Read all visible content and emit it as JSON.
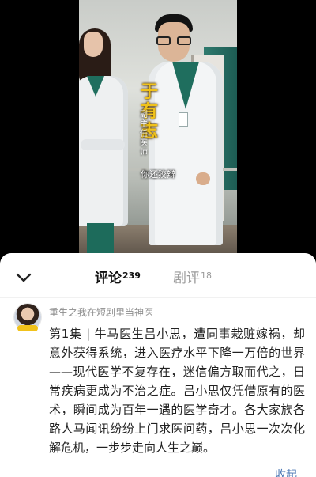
{
  "video": {
    "name_tag": "于有志",
    "role_tag": "副主任医师",
    "subtitle": "你还狡辩"
  },
  "tabs": [
    {
      "label": "评论",
      "count": "239",
      "active": true
    },
    {
      "label": "剧评",
      "count": "18",
      "active": false
    }
  ],
  "comment": {
    "username": "重生之我在短剧里当神医",
    "avatar_icon": "user-avatar",
    "text": "第1集 | 牛马医生吕小思，遭同事栽赃嫁祸，却意外获得系统，进入医疗水平下降一万倍的世界——现代医学不复存在，迷信偏方取而代之，日常疾病更成为不治之症。吕小思仅凭借原有的医术，瞬间成为百年一遇的医学奇才。各大家族各路人马闻讯纷纷上门求医问药，吕小思一次次化解危机，一步步走向人生之巅。",
    "collapse_label": "收起"
  },
  "colors": {
    "accent_link": "#4c78b5",
    "name_tag": "#f0c21a",
    "inactive_tab": "#9a9a9a"
  }
}
